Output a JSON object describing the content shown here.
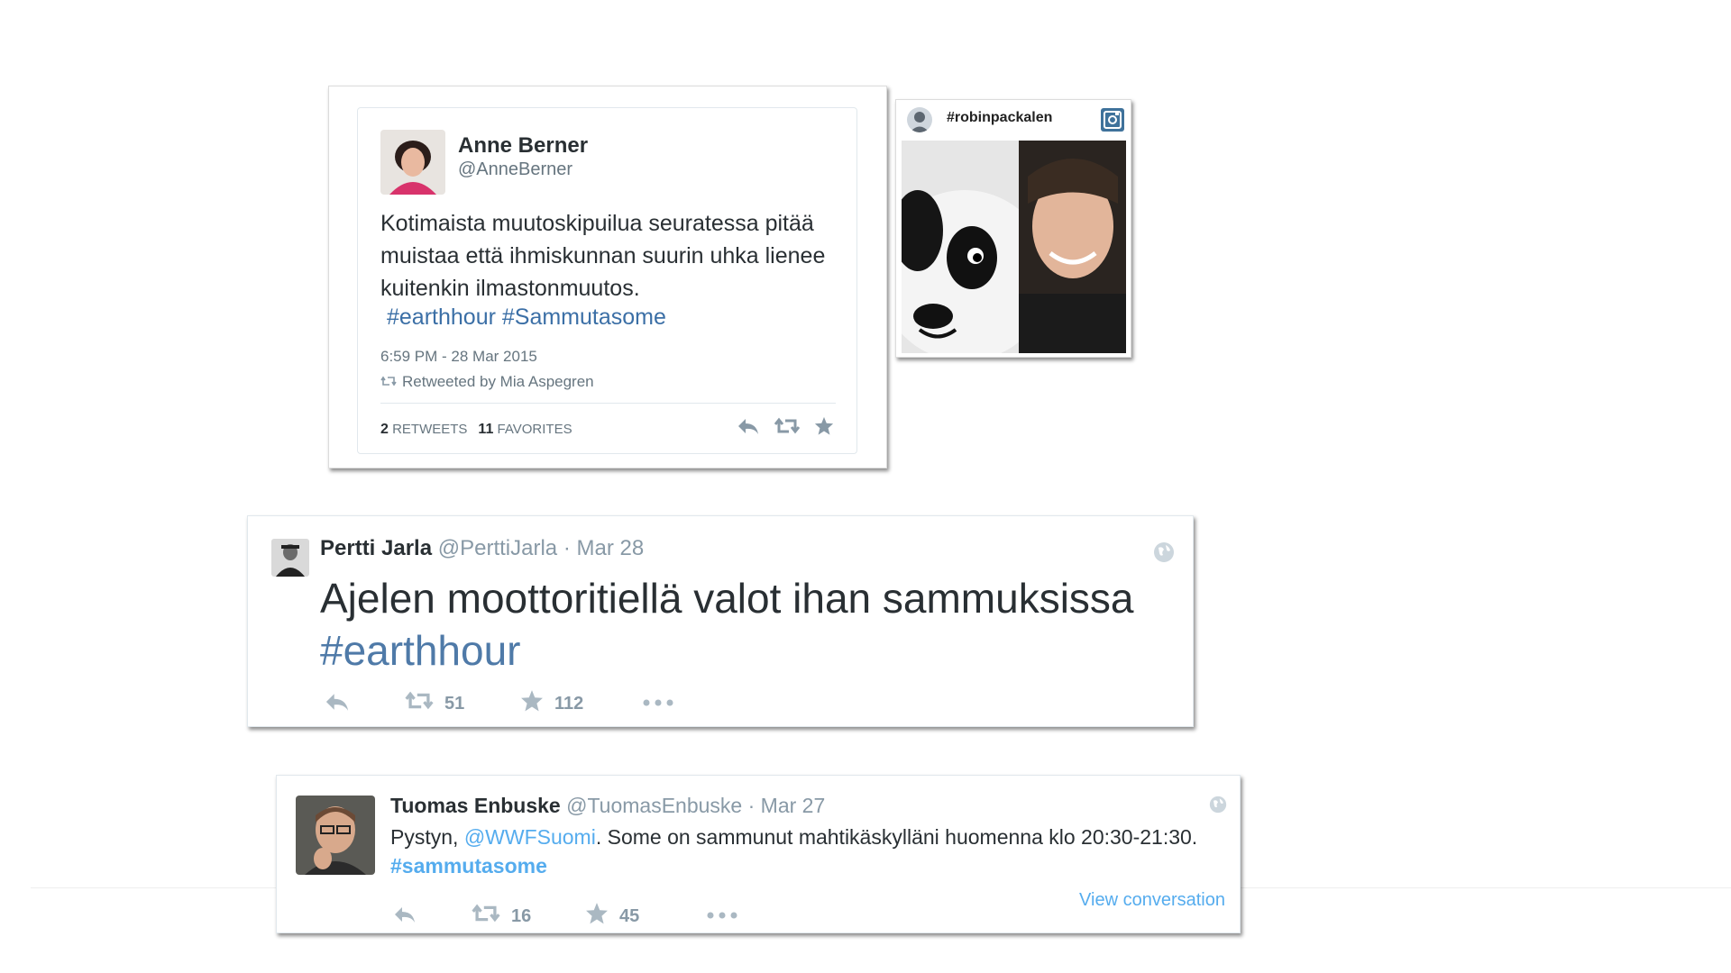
{
  "tweet1": {
    "name": "Anne Berner",
    "handle": "@AnneBerner",
    "text": "Kotimaista muutoskipuilua seuratessa pitää muistaa että ihmiskunnan suurin uhka lienee kuitenkin ilmastonmuutos.",
    "hashtags": "#earthhour #Sammutasome",
    "timestamp": "6:59 PM - 28 Mar 2015",
    "retweeted_by": "Retweeted by Mia Aspegren",
    "retweets_count": "2",
    "retweets_label": "RETWEETS",
    "favorites_count": "11",
    "favorites_label": "FAVORITES",
    "icons": [
      "reply-icon",
      "retweet-icon",
      "star-icon"
    ]
  },
  "instagram": {
    "hashtag": "#robinpackalen",
    "icons": [
      "instagram-icon"
    ]
  },
  "tweet2": {
    "name": "Pertti Jarla",
    "handle": "@PerttiJarla",
    "date": "Mar 28",
    "text_line1": "Ajelen moottoritiellä valot ihan sammuksissa",
    "hashtag": "#earthhour",
    "retweets": "51",
    "favorites": "112"
  },
  "tweet3": {
    "name": "Tuomas Enbuske",
    "handle": "@TuomasEnbuske",
    "date": "Mar 27",
    "text_prefix": "Pystyn, ",
    "mention": "@WWFSuomi",
    "text_middle": ". Some on sammunut mahtikäskylläni huomenna klo 20:30-21:30. ",
    "hashtag": "#sammutasome",
    "retweets": "16",
    "favorites": "45",
    "view_conversation": "View conversation"
  },
  "colors": {
    "link": "#55acee",
    "hashtag_dark": "#3b6fa6",
    "text": "#292f33",
    "muted": "#8899a6"
  }
}
